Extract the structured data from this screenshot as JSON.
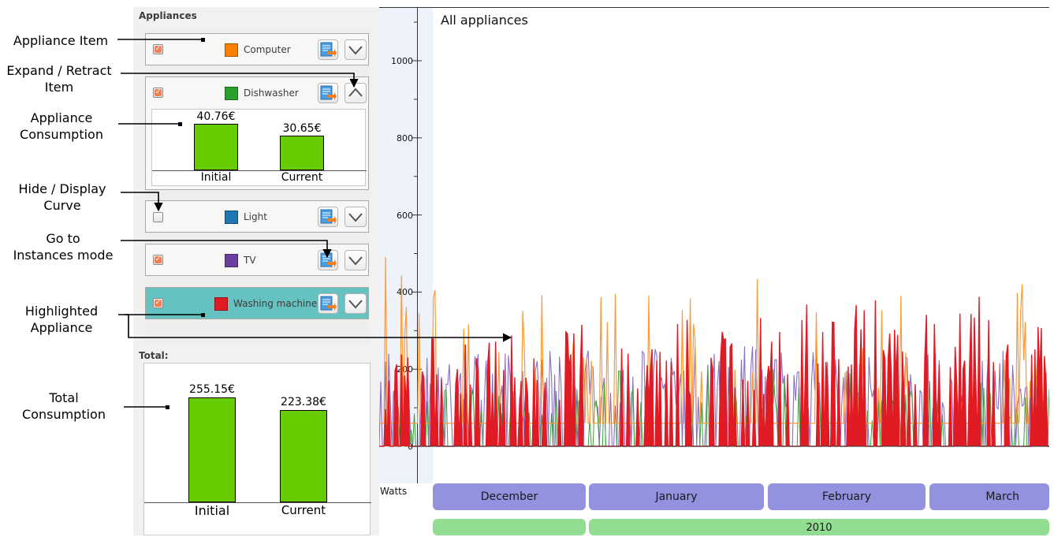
{
  "left_panel": {
    "appliances_title": "Appliances",
    "total_title": "Total:"
  },
  "appliances": [
    {
      "name": "Computer",
      "color": "#ff8000",
      "checked": true,
      "highlighted": false
    },
    {
      "name": "Dishwasher",
      "color": "#2ca02c",
      "checked": true,
      "highlighted": false,
      "expanded": true,
      "consumption": {
        "initial_label": "Initial",
        "current_label": "Current",
        "initial_value": "40.76€",
        "current_value": "30.65€",
        "initial": 40.76,
        "current": 30.65
      }
    },
    {
      "name": "Light",
      "color": "#1f77b4",
      "checked": false,
      "highlighted": false
    },
    {
      "name": "TV",
      "color": "#6a3fa0",
      "checked": true,
      "highlighted": false
    },
    {
      "name": "Washing machine",
      "color": "#e01b24",
      "checked": true,
      "highlighted": true
    }
  ],
  "total": {
    "initial_label": "Initial",
    "current_label": "Current",
    "initial_value": "255.15€",
    "current_value": "223.38€",
    "initial": 255.15,
    "current": 223.38
  },
  "callouts": {
    "appliance_item": "Appliance Item",
    "expand_1": "Expand / Retract",
    "expand_2": "Item",
    "consumption_1": "Appliance",
    "consumption_2": "Consumption",
    "hide_1": "Hide / Display",
    "hide_2": "Curve",
    "goto_1": "Go to",
    "goto_2": "Instances mode",
    "highlight_1": "Highlighted",
    "highlight_2": "Appliance",
    "total_1": "Total",
    "total_2": "Consumption"
  },
  "chart": {
    "title": "All appliances",
    "ylabel": "Watts",
    "months": [
      "December",
      "January",
      "February",
      "March"
    ],
    "year": "2010"
  },
  "chart_data": {
    "type": "line",
    "title": "All appliances",
    "ylabel": "Watts",
    "ylim": [
      0,
      1100
    ],
    "yticks": [
      0,
      200,
      400,
      600,
      800,
      1000
    ],
    "x_categories": [
      "December",
      "January",
      "February",
      "March"
    ],
    "x_group": "2010",
    "series": [
      {
        "name": "Washing machine",
        "color": "#e01b24",
        "peak_values": [
          260,
          280,
          300,
          290,
          330,
          340,
          300,
          370,
          360,
          380,
          400,
          420,
          350,
          360,
          390,
          380
        ]
      },
      {
        "name": "Computer",
        "color": "#ff9933",
        "peak_values": [
          510,
          490,
          380,
          410,
          400,
          400,
          410,
          420,
          450,
          440,
          430,
          420,
          400,
          380,
          360,
          420
        ]
      },
      {
        "name": "TV",
        "color": "#8a6fc0",
        "peak_values": [
          240,
          250,
          260,
          250,
          250,
          260,
          260,
          270,
          260,
          250,
          260,
          250,
          240,
          250,
          260,
          250
        ]
      },
      {
        "name": "Dishwasher",
        "color": "#3aa03a",
        "peak_values": [
          120,
          160,
          150,
          170,
          160,
          200,
          180,
          210,
          190,
          220,
          200,
          190,
          180,
          170,
          190,
          180
        ]
      }
    ]
  }
}
